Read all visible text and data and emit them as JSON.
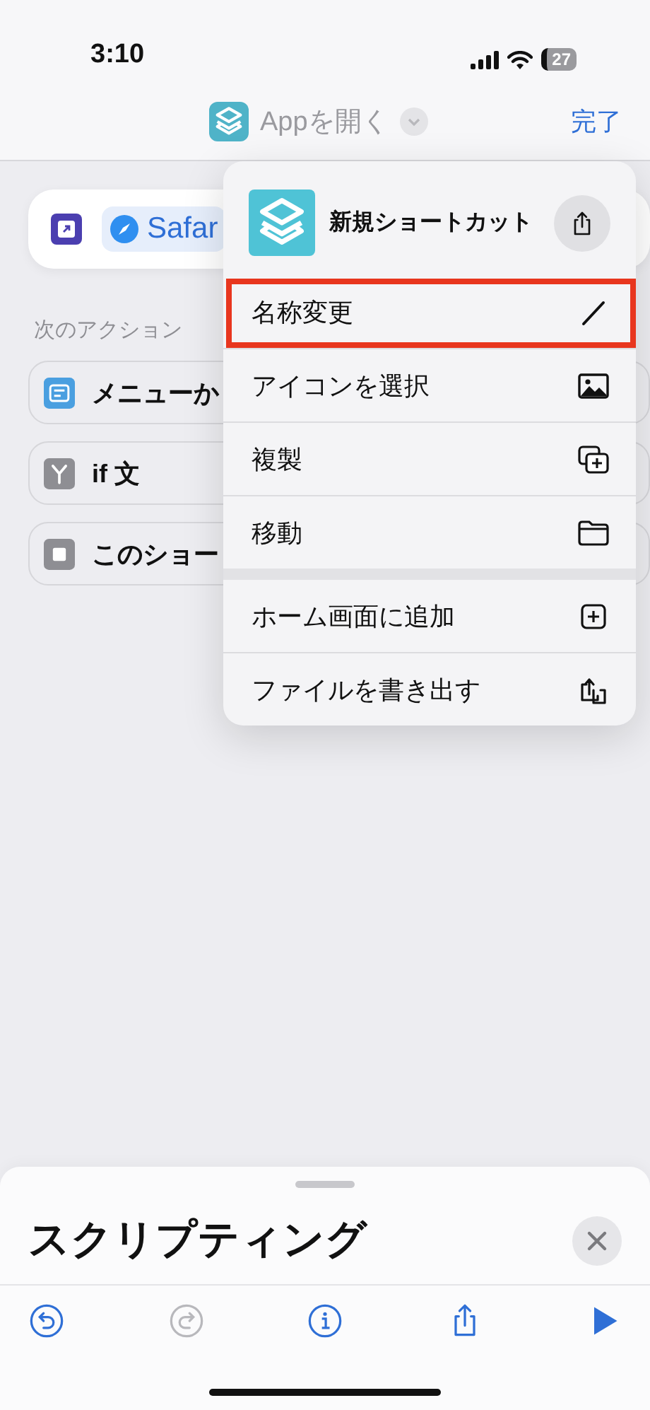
{
  "status_bar": {
    "time": "3:10",
    "battery": "27"
  },
  "nav": {
    "title": "Appを開く",
    "done": "完了"
  },
  "action_card": {
    "app": "Safar"
  },
  "next_actions": {
    "heading": "次のアクション",
    "items": [
      {
        "kind": "menu",
        "label": "メニューか"
      },
      {
        "kind": "if",
        "label": "if 文"
      },
      {
        "kind": "stop",
        "label": "このショー"
      }
    ]
  },
  "menu": {
    "title": "新規ショートカット",
    "groups": [
      {
        "items": [
          {
            "kind": "rename",
            "label": "名称変更",
            "highlighted": true
          },
          {
            "kind": "icon",
            "label": "アイコンを選択",
            "highlighted": false
          },
          {
            "kind": "duplicate",
            "label": "複製",
            "highlighted": false
          },
          {
            "kind": "move",
            "label": "移動",
            "highlighted": false
          }
        ]
      },
      {
        "items": [
          {
            "kind": "home",
            "label": "ホーム画面に追加",
            "highlighted": false
          },
          {
            "kind": "export",
            "label": "ファイルを書き出す",
            "highlighted": false
          }
        ]
      }
    ]
  },
  "sheet": {
    "title": "スクリプティング",
    "toolbar": [
      {
        "kind": "undo",
        "disabled": false
      },
      {
        "kind": "redo",
        "disabled": true
      },
      {
        "kind": "info",
        "disabled": false
      },
      {
        "kind": "share",
        "disabled": false
      },
      {
        "kind": "run",
        "disabled": false
      }
    ]
  }
}
